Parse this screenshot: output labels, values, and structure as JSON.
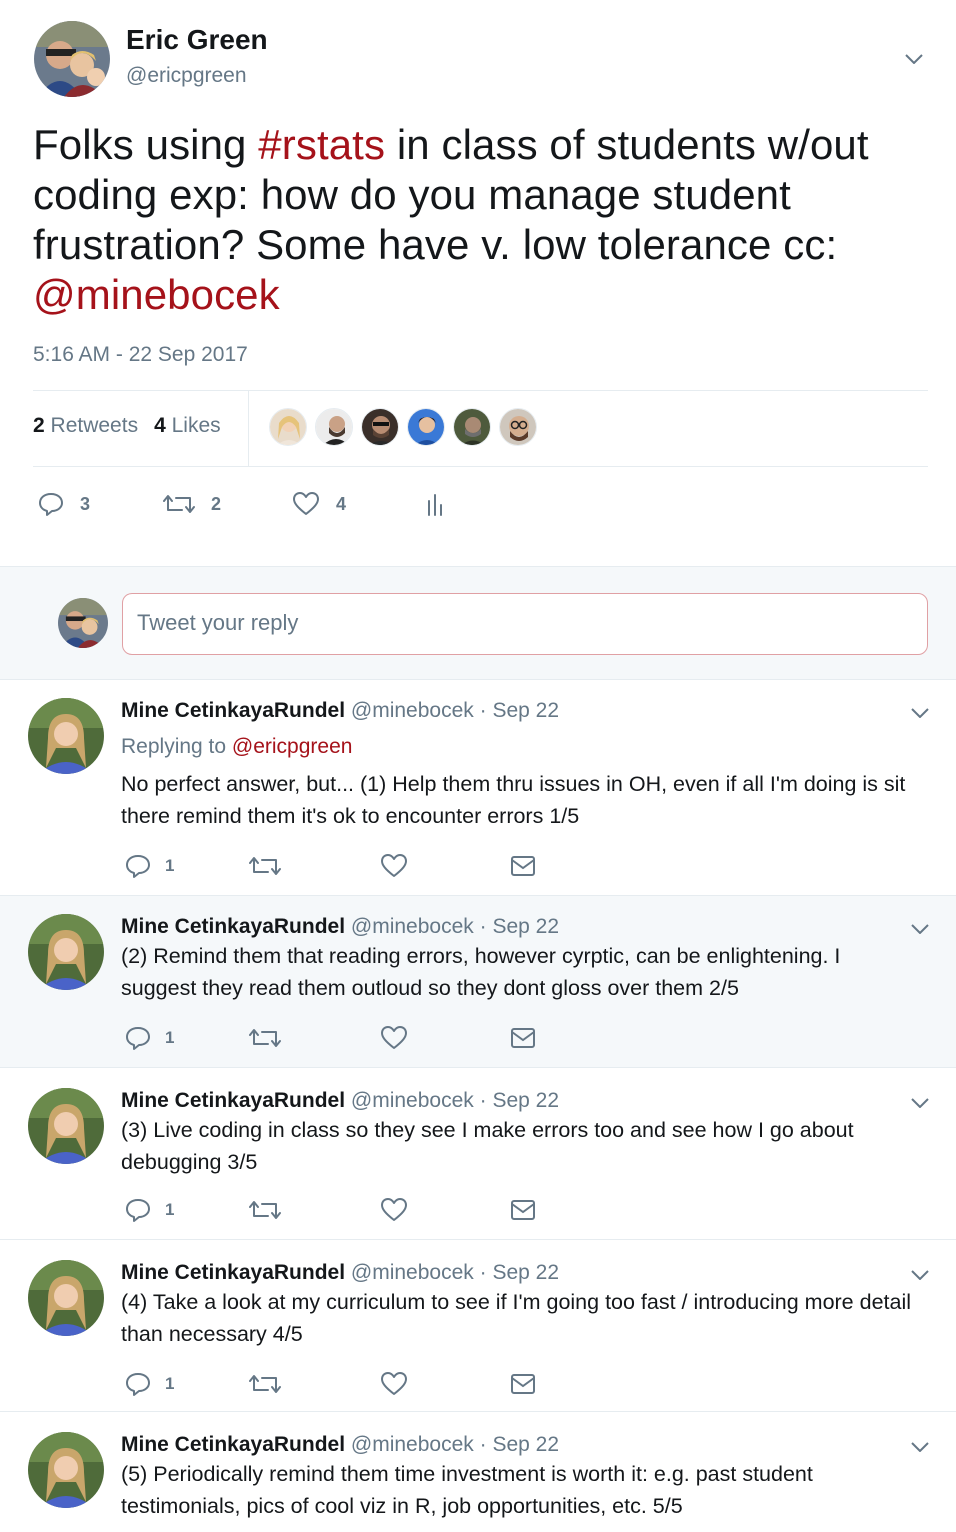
{
  "main_tweet": {
    "author_name": "Eric Green",
    "author_handle": "@ericpgreen",
    "text_1": "Folks using ",
    "hashtag": "#rstats",
    "text_2": " in class of students w/out coding exp: how do you manage student frustration? Some have v. low tolerance cc: ",
    "mention": "@minebocek",
    "timestamp": "5:16 AM - 22 Sep 2017",
    "retweets_count": "2",
    "retweets_label": "Retweets",
    "likes_count": "4",
    "likes_label": "Likes",
    "reply_count": "3",
    "retweet_count": "2",
    "like_count": "4"
  },
  "reply_box": {
    "placeholder": "Tweet your reply"
  },
  "replies": [
    {
      "name": "Mine CetinkayaRundel",
      "handle": "@minebocek",
      "date": "· Sep 22",
      "replying_label": "Replying to",
      "replying_to": "@ericpgreen",
      "text": "No perfect answer, but... (1) Help them thru issues in OH, even if all I'm doing is sit there remind them it's ok to encounter errors 1/5",
      "reply_count": "1"
    },
    {
      "name": "Mine CetinkayaRundel",
      "handle": "@minebocek",
      "date": "· Sep 22",
      "text": "(2) Remind them that reading errors, however cyrptic, can be enlightening. I suggest they read them outloud so they dont gloss over them 2/5",
      "reply_count": "1"
    },
    {
      "name": "Mine CetinkayaRundel",
      "handle": "@minebocek",
      "date": "· Sep 22",
      "text": "(3) Live coding in class so they see I make errors too and see how I go about debugging 3/5",
      "reply_count": "1"
    },
    {
      "name": "Mine CetinkayaRundel",
      "handle": "@minebocek",
      "date": "· Sep 22",
      "text": "(4) Take a look at my curriculum to see if I'm going too fast / introducing more detail than necessary 4/5",
      "reply_count": "1"
    },
    {
      "name": "Mine CetinkayaRundel",
      "handle": "@minebocek",
      "date": "· Sep 22",
      "text": "(5) Periodically remind them time investment is worth it: e.g. past student testimonials, pics of cool viz in R, job opportunities, etc. 5/5"
    }
  ],
  "colors": {
    "accent": "#a5121a",
    "muted": "#657786",
    "text": "#14171a",
    "highlight_bg": "#f5f8fa",
    "thread_line": "#d9a3a6"
  },
  "icons": [
    "chevron-down-icon",
    "reply-icon",
    "retweet-icon",
    "heart-icon",
    "analytics-icon",
    "mail-icon"
  ]
}
